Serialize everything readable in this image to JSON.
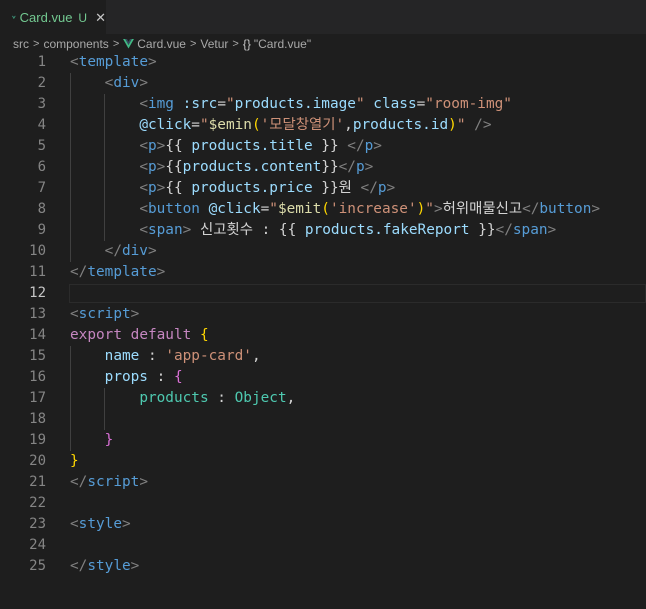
{
  "tab": {
    "filename": "Card.vue",
    "status": "U",
    "close": "✕"
  },
  "breadcrumb": {
    "items": [
      "src",
      "components",
      "Card.vue",
      "Vetur",
      "\"Card.vue\""
    ],
    "object_symbol": "{}"
  },
  "editor": {
    "current_line": 12,
    "lines": [
      {
        "n": "1",
        "tokens": [
          [
            "t-br",
            "<"
          ],
          [
            "t-tag",
            "template"
          ],
          [
            "t-br",
            ">"
          ]
        ]
      },
      {
        "n": "2",
        "tokens": [
          [
            "t-pl",
            "    "
          ],
          [
            "t-br",
            "<"
          ],
          [
            "t-tag",
            "div"
          ],
          [
            "t-br",
            ">"
          ]
        ]
      },
      {
        "n": "3",
        "tokens": [
          [
            "t-pl",
            "        "
          ],
          [
            "t-br",
            "<"
          ],
          [
            "t-tag",
            "img"
          ],
          [
            "t-pl",
            " "
          ],
          [
            "t-attr",
            ":src"
          ],
          [
            "t-pl",
            "="
          ],
          [
            "t-str",
            "\""
          ],
          [
            "t-var",
            "products.image"
          ],
          [
            "t-str",
            "\""
          ],
          [
            "t-pl",
            " "
          ],
          [
            "t-attr",
            "class"
          ],
          [
            "t-pl",
            "="
          ],
          [
            "t-str",
            "\"room-img\""
          ]
        ]
      },
      {
        "n": "4",
        "tokens": [
          [
            "t-pl",
            "        "
          ],
          [
            "t-attr",
            "@click"
          ],
          [
            "t-pl",
            "="
          ],
          [
            "t-str",
            "\""
          ],
          [
            "t-fn",
            "$emin"
          ],
          [
            "t-y",
            "("
          ],
          [
            "t-str",
            "'모달창열기'"
          ],
          [
            "t-pl",
            ","
          ],
          [
            "t-var",
            "products.id"
          ],
          [
            "t-y",
            ")"
          ],
          [
            "t-str",
            "\""
          ],
          [
            "t-pl",
            " "
          ],
          [
            "t-br",
            "/>"
          ]
        ]
      },
      {
        "n": "5",
        "tokens": [
          [
            "t-pl",
            "        "
          ],
          [
            "t-br",
            "<"
          ],
          [
            "t-tag",
            "p"
          ],
          [
            "t-br",
            ">"
          ],
          [
            "t-txt",
            "{{ "
          ],
          [
            "t-var",
            "products.title"
          ],
          [
            "t-txt",
            " }} "
          ],
          [
            "t-br",
            "</"
          ],
          [
            "t-tag",
            "p"
          ],
          [
            "t-br",
            ">"
          ]
        ]
      },
      {
        "n": "6",
        "tokens": [
          [
            "t-pl",
            "        "
          ],
          [
            "t-br",
            "<"
          ],
          [
            "t-tag",
            "p"
          ],
          [
            "t-br",
            ">"
          ],
          [
            "t-txt",
            "{{"
          ],
          [
            "t-var",
            "products.content"
          ],
          [
            "t-txt",
            "}}"
          ],
          [
            "t-br",
            "</"
          ],
          [
            "t-tag",
            "p"
          ],
          [
            "t-br",
            ">"
          ]
        ]
      },
      {
        "n": "7",
        "tokens": [
          [
            "t-pl",
            "        "
          ],
          [
            "t-br",
            "<"
          ],
          [
            "t-tag",
            "p"
          ],
          [
            "t-br",
            ">"
          ],
          [
            "t-txt",
            "{{ "
          ],
          [
            "t-var",
            "products.price"
          ],
          [
            "t-txt",
            " }}원 "
          ],
          [
            "t-br",
            "</"
          ],
          [
            "t-tag",
            "p"
          ],
          [
            "t-br",
            ">"
          ]
        ]
      },
      {
        "n": "8",
        "tokens": [
          [
            "t-pl",
            "        "
          ],
          [
            "t-br",
            "<"
          ],
          [
            "t-tag",
            "button"
          ],
          [
            "t-pl",
            " "
          ],
          [
            "t-attr",
            "@click"
          ],
          [
            "t-pl",
            "="
          ],
          [
            "t-str",
            "\""
          ],
          [
            "t-fn",
            "$emit"
          ],
          [
            "t-y",
            "("
          ],
          [
            "t-str",
            "'increase'"
          ],
          [
            "t-y",
            ")"
          ],
          [
            "t-str",
            "\""
          ],
          [
            "t-br",
            ">"
          ],
          [
            "t-txt",
            "허위매물신고"
          ],
          [
            "t-br",
            "</"
          ],
          [
            "t-tag",
            "button"
          ],
          [
            "t-br",
            ">"
          ]
        ]
      },
      {
        "n": "9",
        "tokens": [
          [
            "t-pl",
            "        "
          ],
          [
            "t-br",
            "<"
          ],
          [
            "t-tag",
            "span"
          ],
          [
            "t-br",
            ">"
          ],
          [
            "t-txt",
            " 신고횟수 : {{ "
          ],
          [
            "t-var",
            "products.fakeReport"
          ],
          [
            "t-txt",
            " }}"
          ],
          [
            "t-br",
            "</"
          ],
          [
            "t-tag",
            "span"
          ],
          [
            "t-br",
            ">"
          ]
        ]
      },
      {
        "n": "10",
        "tokens": [
          [
            "t-pl",
            "    "
          ],
          [
            "t-br",
            "</"
          ],
          [
            "t-tag",
            "div"
          ],
          [
            "t-br",
            ">"
          ]
        ]
      },
      {
        "n": "11",
        "tokens": [
          [
            "t-br",
            "</"
          ],
          [
            "t-tag",
            "template"
          ],
          [
            "t-br",
            ">"
          ]
        ]
      },
      {
        "n": "12",
        "tokens": []
      },
      {
        "n": "13",
        "tokens": [
          [
            "t-br",
            "<"
          ],
          [
            "t-tag",
            "script"
          ],
          [
            "t-br",
            ">"
          ]
        ]
      },
      {
        "n": "14",
        "tokens": [
          [
            "t-kw",
            "export"
          ],
          [
            "t-pl",
            " "
          ],
          [
            "t-kw",
            "default"
          ],
          [
            "t-pl",
            " "
          ],
          [
            "t-y",
            "{"
          ]
        ]
      },
      {
        "n": "15",
        "tokens": [
          [
            "t-pl",
            "    "
          ],
          [
            "t-var",
            "name"
          ],
          [
            "t-pl",
            " : "
          ],
          [
            "t-str",
            "'app-card'"
          ],
          [
            "t-pl",
            ","
          ]
        ]
      },
      {
        "n": "16",
        "tokens": [
          [
            "t-pl",
            "    "
          ],
          [
            "t-var",
            "props"
          ],
          [
            "t-pl",
            " : "
          ],
          [
            "t-p",
            "{"
          ]
        ]
      },
      {
        "n": "17",
        "tokens": [
          [
            "t-pl",
            "        "
          ],
          [
            "t-type",
            "products"
          ],
          [
            "t-pl",
            " : "
          ],
          [
            "t-type",
            "Object"
          ],
          [
            "t-pl",
            ","
          ]
        ]
      },
      {
        "n": "18",
        "tokens": []
      },
      {
        "n": "19",
        "tokens": [
          [
            "t-pl",
            "    "
          ],
          [
            "t-p",
            "}"
          ]
        ]
      },
      {
        "n": "20",
        "tokens": [
          [
            "t-y",
            "}"
          ]
        ]
      },
      {
        "n": "21",
        "tokens": [
          [
            "t-br",
            "</"
          ],
          [
            "t-tag",
            "script"
          ],
          [
            "t-br",
            ">"
          ]
        ]
      },
      {
        "n": "22",
        "tokens": []
      },
      {
        "n": "23",
        "tokens": [
          [
            "t-br",
            "<"
          ],
          [
            "t-tag",
            "style"
          ],
          [
            "t-br",
            ">"
          ]
        ]
      },
      {
        "n": "24",
        "tokens": []
      },
      {
        "n": "25",
        "tokens": [
          [
            "t-br",
            "</"
          ],
          [
            "t-tag",
            "style"
          ],
          [
            "t-br",
            ">"
          ]
        ]
      }
    ]
  },
  "colors": {
    "vue_green": "#41b883",
    "vue_dark": "#35495e",
    "modified_green": "#73c991"
  }
}
